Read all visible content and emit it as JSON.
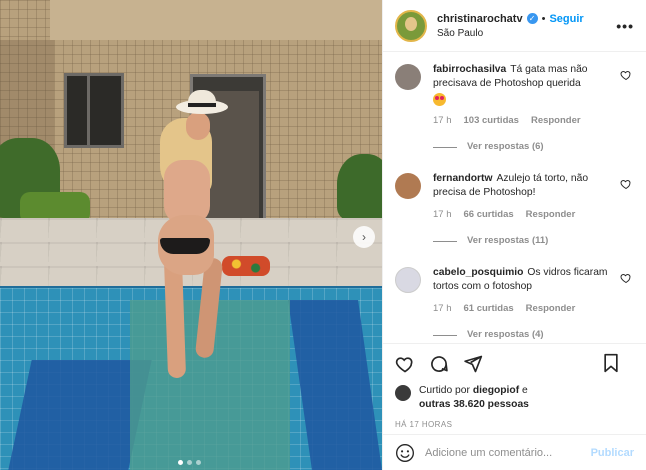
{
  "post": {
    "username": "christinarochatv",
    "separator": "•",
    "follow_label": "Seguir",
    "location": "São Paulo",
    "more_icon": "•••"
  },
  "carousel": {
    "next_icon": "›",
    "total": 3,
    "current": 1
  },
  "comments": [
    {
      "user": "fabirrochasilva",
      "text": "Tá gata mas não precisava de Photoshop querida",
      "has_emoji": true,
      "emoji_icon": "heart-eyes-emoji",
      "time": "17 h",
      "likes": "103 curtidas",
      "reply": "Responder",
      "view_replies": "Ver respostas (6)",
      "avatar_color": "#8a7f78"
    },
    {
      "user": "fernandortw",
      "text": "Azulejo tá torto, não precisa de Photoshop!",
      "has_emoji": false,
      "time": "17 h",
      "likes": "66 curtidas",
      "reply": "Responder",
      "view_replies": "Ver respostas (11)",
      "avatar_color": "#b07a52"
    },
    {
      "user": "cabelo_posquimio",
      "text": "Os vidros ficaram tortos com o fotoshop",
      "has_emoji": false,
      "time": "17 h",
      "likes": "61 curtidas",
      "reply": "Responder",
      "view_replies": "Ver respostas (4)",
      "avatar_color": "#d9d9e3"
    }
  ],
  "actions": {
    "liked_prefix": "Curtido por",
    "liked_user": "diegopiof",
    "liked_connector": "e",
    "liked_others": "outras 38.620 pessoas",
    "time": "HÁ 17 HORAS"
  },
  "add_comment": {
    "placeholder": "Adicione um comentário...",
    "publish_label": "Publicar"
  },
  "colors": {
    "link": "#0095f6",
    "muted": "#8e8e8e",
    "publish_disabled": "#b3dbff"
  }
}
